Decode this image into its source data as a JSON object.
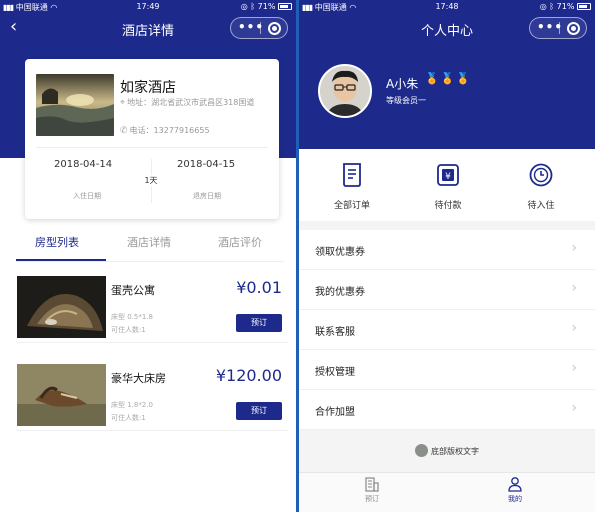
{
  "status_bar": {
    "carrier": "中国联通",
    "left_time": "17:49",
    "right_time": "17:48",
    "battery": "71%"
  },
  "left_screen": {
    "nav_title": "酒店详情",
    "hotel": {
      "name": "如家酒店",
      "address_label": "地址：",
      "address": "湖北省武汉市武昌区318国道",
      "phone_label": "电话：",
      "phone": "13277916655"
    },
    "booking": {
      "checkin_date": "2018-04-14",
      "checkout_date": "2018-04-15",
      "nights": "1天",
      "checkin_label": "入住日期",
      "checkout_label": "退房日期"
    },
    "tabs": [
      {
        "label": "房型列表"
      },
      {
        "label": "酒店详情"
      },
      {
        "label": "酒店评价"
      }
    ],
    "rooms": [
      {
        "name": "蛋壳公寓",
        "price": "¥0.01",
        "bed": "床型 0.5*1.8",
        "capacity": "可住人数:1",
        "button": "预订"
      },
      {
        "name": "豪华大床房",
        "price": "¥120.00",
        "bed": "床型 1.8*2.0",
        "capacity": "可住人数:1",
        "button": "预订"
      }
    ]
  },
  "right_screen": {
    "nav_title": "个人中心",
    "user": {
      "name": "A小朱",
      "level": "等级会员一"
    },
    "orders": [
      {
        "label": "全部订单",
        "icon": "document-icon"
      },
      {
        "label": "待付款",
        "icon": "yuan-wallet-icon"
      },
      {
        "label": "待入住",
        "icon": "clock-icon"
      }
    ],
    "menu": [
      {
        "label": "领取优惠券"
      },
      {
        "label": "我的优惠券"
      },
      {
        "label": "联系客服"
      },
      {
        "label": "授权管理"
      },
      {
        "label": "合作加盟"
      }
    ],
    "footer_text": "底部版权文字",
    "tabbar": [
      {
        "label": "预订",
        "icon": "building-icon"
      },
      {
        "label": "我的",
        "icon": "person-icon"
      }
    ]
  },
  "colors": {
    "brand": "#1d2a8c",
    "divider": "#1f5fb5",
    "muted_text": "#999999",
    "medal": "#e8b93a"
  }
}
